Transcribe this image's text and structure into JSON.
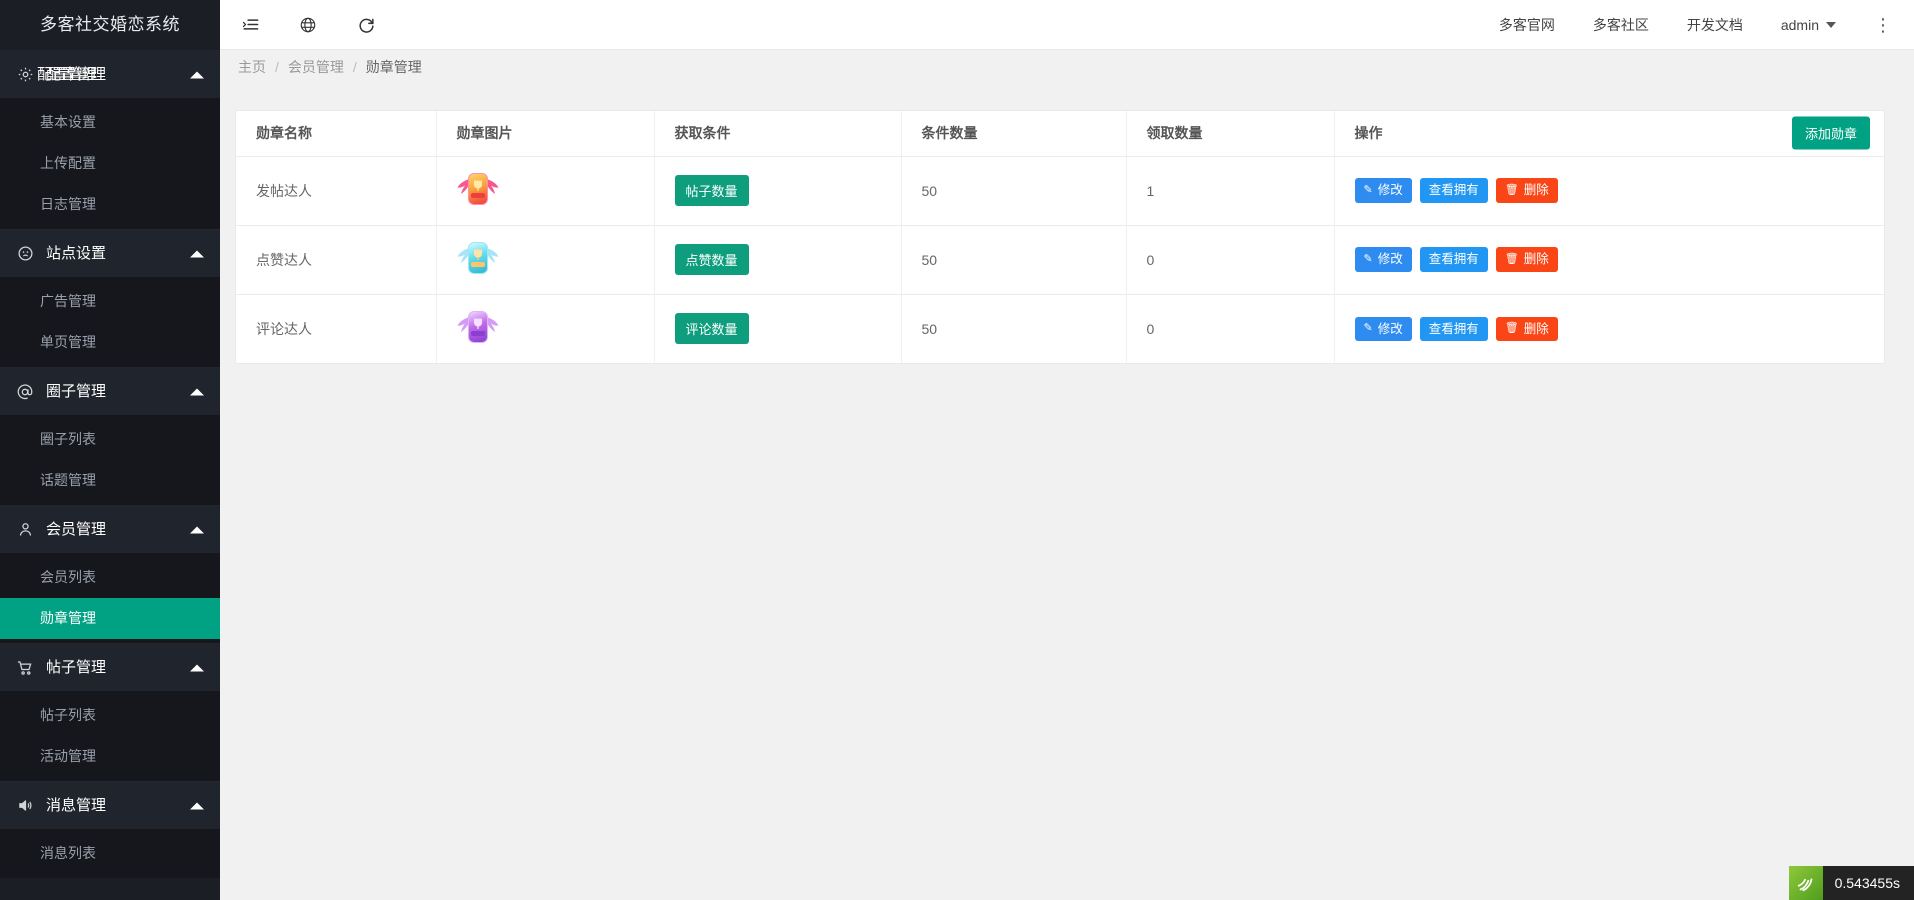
{
  "sidebar": {
    "brand": "多客社交婚恋系统",
    "groups": [
      {
        "label": "配置管理",
        "icon": "gear-icon",
        "items": [
          {
            "label": "基本设置"
          },
          {
            "label": "上传配置"
          },
          {
            "label": "日志管理"
          }
        ]
      },
      {
        "label": "站点设置",
        "icon": "compass-icon",
        "items": [
          {
            "label": "广告管理"
          },
          {
            "label": "单页管理"
          }
        ]
      },
      {
        "label": "圈子管理",
        "icon": "at-icon",
        "items": [
          {
            "label": "圈子列表"
          },
          {
            "label": "话题管理"
          }
        ]
      },
      {
        "label": "会员管理",
        "icon": "user-icon",
        "items": [
          {
            "label": "会员列表"
          },
          {
            "label": "勋章管理"
          }
        ]
      },
      {
        "label": "帖子管理",
        "icon": "cart-icon",
        "items": [
          {
            "label": "帖子列表"
          },
          {
            "label": "活动管理"
          }
        ]
      },
      {
        "label": "消息管理",
        "icon": "speaker-icon",
        "items": [
          {
            "label": "消息列表"
          }
        ]
      }
    ],
    "active_item": "勋章管理",
    "active_color": "#00a283"
  },
  "topbar": {
    "icons": [
      "menu-collapse-icon",
      "globe-icon",
      "refresh-icon"
    ],
    "links": [
      "多客官网",
      "多客社区",
      "开发文档"
    ],
    "user": "admin",
    "more": "⋮"
  },
  "breadcrumb": {
    "home": "主页",
    "parent": "会员管理",
    "current": "勋章管理",
    "separator": "/"
  },
  "table": {
    "headers": {
      "name": "勋章名称",
      "image": "勋章图片",
      "condition": "获取条件",
      "condition_count": "条件数量",
      "claim_count": "领取数量",
      "operation": "操作"
    },
    "add_button": "添加勋章",
    "ops": {
      "edit": "修改",
      "view": "查看拥有",
      "delete": "删除",
      "edit_icon": "pencil-icon",
      "delete_icon": "trash-icon"
    },
    "rows": [
      {
        "name": "发帖达人",
        "badge_icon": "medal-badge-red",
        "badge_colors": {
          "wing": "#f7588f",
          "shield": "#f9a23b",
          "accent": "#ef3e3e",
          "cup": "#ffd96b"
        },
        "condition": "帖子数量",
        "condition_count": "50",
        "claim_count": "1"
      },
      {
        "name": "点赞达人",
        "badge_icon": "medal-badge-blue",
        "badge_colors": {
          "wing": "#9fdcf7",
          "shield": "#46c7d8",
          "accent": "#2fb6cf",
          "cup": "#ffc46b"
        },
        "condition": "点赞数量",
        "condition_count": "50",
        "claim_count": "0"
      },
      {
        "name": "评论达人",
        "badge_icon": "medal-badge-purple",
        "badge_colors": {
          "wing": "#d59bf6",
          "shield": "#b05ce0",
          "accent": "#8a3fd1",
          "cup": "#ffd96b"
        },
        "condition": "评论数量",
        "condition_count": "50",
        "claim_count": "0"
      }
    ]
  },
  "debugbar": {
    "logo": "thinkphp-logo",
    "time": "0.543455s"
  }
}
